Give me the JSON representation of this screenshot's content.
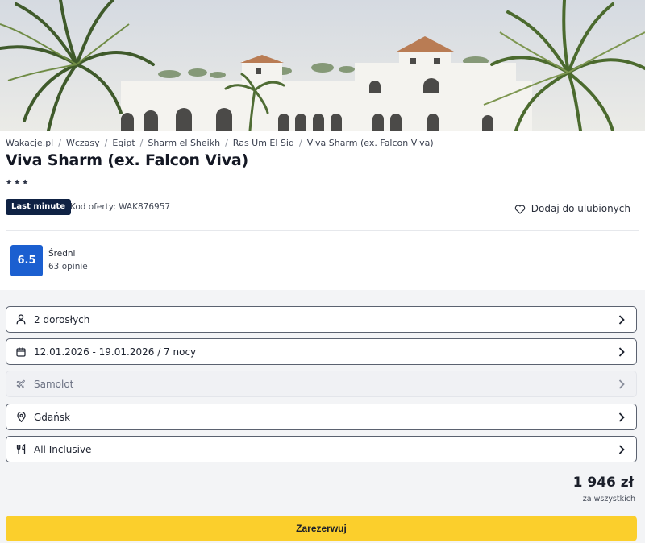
{
  "breadcrumb": [
    {
      "label": "Wakacje.pl"
    },
    {
      "label": "Wczasy"
    },
    {
      "label": "Egipt"
    },
    {
      "label": "Sharm el Sheikh"
    },
    {
      "label": "Ras Um El Sid"
    },
    {
      "label": "Viva Sharm (ex. Falcon Viva)"
    }
  ],
  "hotel": {
    "title": "Viva Sharm (ex. Falcon Viva)",
    "stars": 3,
    "badge": "Last minute",
    "offer_code": "Kod oferty: WAK876957",
    "favorite_label": "Dodaj do ulubionych"
  },
  "rating": {
    "score": "6.5",
    "label": "Średni",
    "count": "63 opinie",
    "color": "#1b5fd0"
  },
  "options": [
    {
      "icon": "person-icon",
      "label": "2 dorosłych",
      "disabled": false
    },
    {
      "icon": "calendar-icon",
      "label": "12.01.2026 - 19.01.2026 / 7 nocy",
      "disabled": false
    },
    {
      "icon": "plane-icon",
      "label": "Samolot",
      "disabled": true
    },
    {
      "icon": "location-pin-icon",
      "label": "Gdańsk",
      "disabled": false
    },
    {
      "icon": "cutlery-icon",
      "label": "All Inclusive",
      "disabled": false
    }
  ],
  "price": {
    "amount": "1 946 zł",
    "note": "za wszystkich"
  },
  "reserve_label": "Zarezerwuj",
  "colors": {
    "badge_bg": "#0f2244",
    "reserve_bg": "#fbcf2c",
    "panel_bg": "#f3f4f6"
  }
}
